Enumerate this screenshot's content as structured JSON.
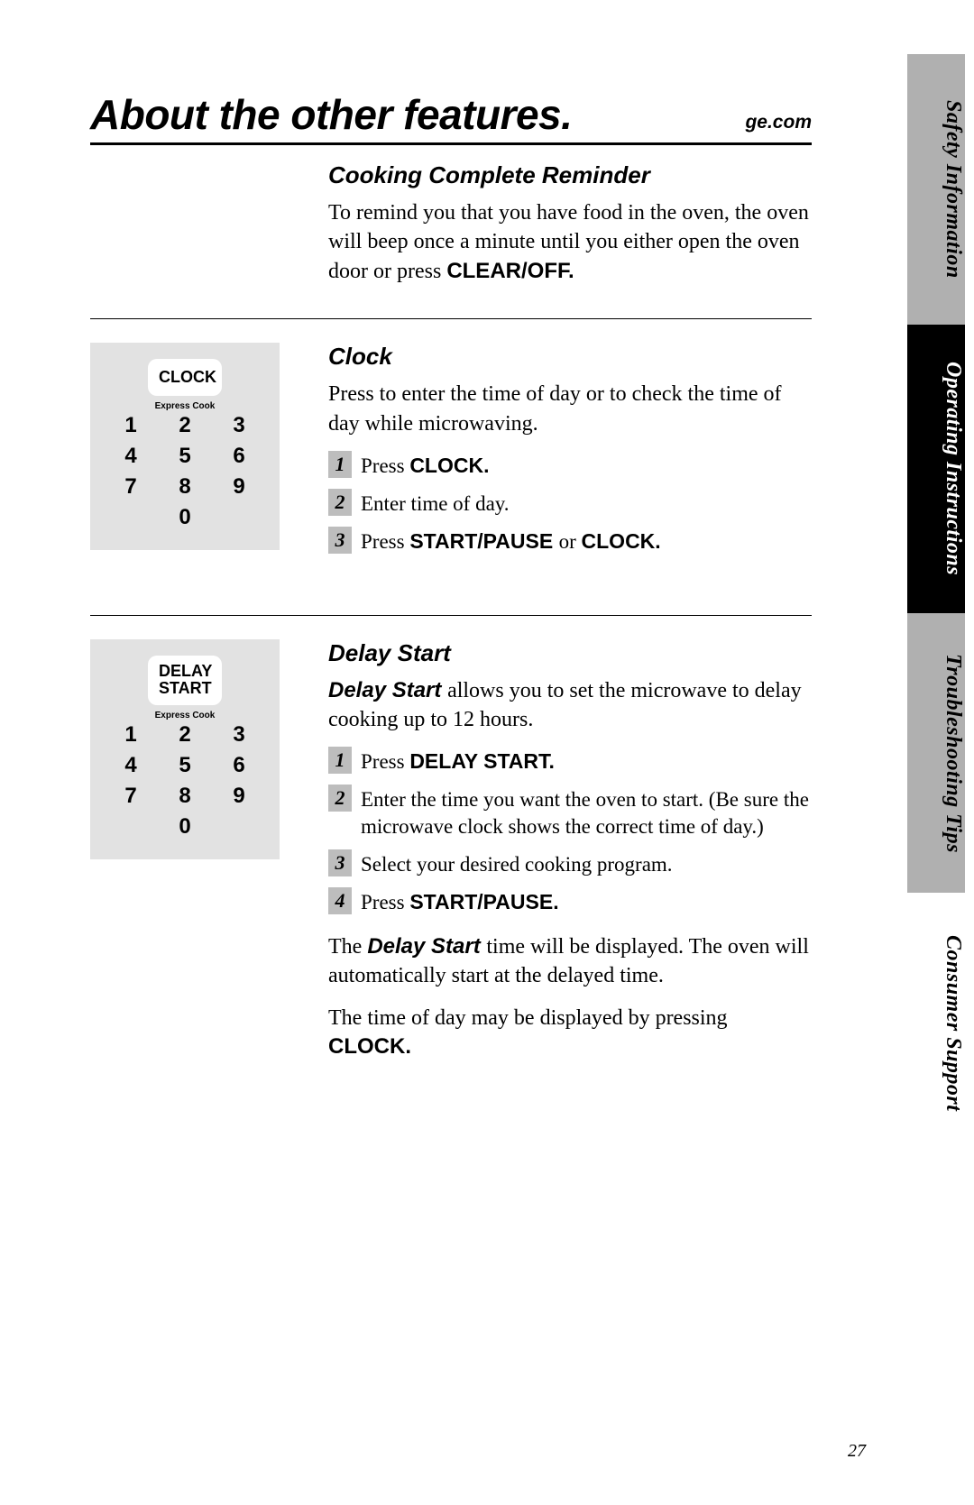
{
  "header": {
    "title": "About the other features.",
    "site": "ge.com"
  },
  "tabs": {
    "safety": "Safety Information",
    "operating": "Operating Instructions",
    "troubleshooting": "Troubleshooting Tips",
    "consumer": "Consumer Support"
  },
  "keypad": {
    "clock_label": "CLOCK",
    "delay1": "DELAY",
    "delay2": "START",
    "express": "Express Cook",
    "keys": [
      "1",
      "2",
      "3",
      "4",
      "5",
      "6",
      "7",
      "8",
      "9",
      "0"
    ]
  },
  "sec1": {
    "title": "Cooking Complete Reminder",
    "p_pre": "To remind you that you have food in the oven, the oven will beep once a minute until you either open the oven door or press ",
    "p_bold": "CLEAR/OFF."
  },
  "sec2": {
    "title": "Clock",
    "intro": "Press to enter the time of day or to check the time of day while microwaving.",
    "s1_pre": "Press ",
    "s1_b": "CLOCK.",
    "s2": "Enter time of day.",
    "s3_pre": "Press ",
    "s3_b1": "START/PAUSE ",
    "s3_mid": "or ",
    "s3_b2": "CLOCK."
  },
  "sec3": {
    "title": "Delay Start",
    "intro_b": "Delay Start ",
    "intro_rest": "allows you to set the microwave to delay cooking up to 12 hours.",
    "s1_pre": "Press ",
    "s1_b": "DELAY START.",
    "s2": "Enter the time you want the oven to start. (Be sure the microwave clock shows the correct time of day.)",
    "s3": "Select your desired cooking program.",
    "s4_pre": "Press ",
    "s4_b": "START/PAUSE.",
    "p2_pre": "The ",
    "p2_b": "Delay Start ",
    "p2_rest": "time will be displayed. The oven will automatically start at the delayed time.",
    "p3_pre": "The time of day may be displayed by pressing ",
    "p3_b": "CLOCK."
  },
  "steps": {
    "n1": "1",
    "n2": "2",
    "n3": "3",
    "n4": "4"
  },
  "page_number": "27"
}
